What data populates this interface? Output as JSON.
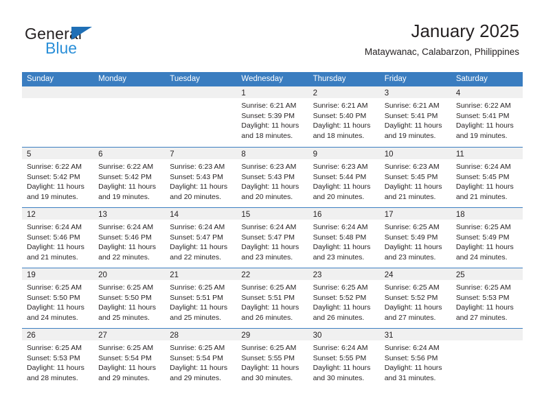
{
  "logo": {
    "word_dark": "General",
    "word_blue": "Blue",
    "triangle_color": "#1f6fb6",
    "blue_color": "#2a8fd8"
  },
  "header": {
    "title": "January 2025",
    "subtitle": "Mataywanac, Calabarzon, Philippines"
  },
  "colors": {
    "header_row_bg": "#3a7dc0",
    "day_band_bg": "#f0f0f0",
    "text": "#231f20"
  },
  "calendar": {
    "weekdays": [
      "Sunday",
      "Monday",
      "Tuesday",
      "Wednesday",
      "Thursday",
      "Friday",
      "Saturday"
    ],
    "weeks": [
      [
        {
          "day": "",
          "lines": []
        },
        {
          "day": "",
          "lines": []
        },
        {
          "day": "",
          "lines": []
        },
        {
          "day": "1",
          "lines": [
            "Sunrise: 6:21 AM",
            "Sunset: 5:39 PM",
            "Daylight: 11 hours",
            "and 18 minutes."
          ]
        },
        {
          "day": "2",
          "lines": [
            "Sunrise: 6:21 AM",
            "Sunset: 5:40 PM",
            "Daylight: 11 hours",
            "and 18 minutes."
          ]
        },
        {
          "day": "3",
          "lines": [
            "Sunrise: 6:21 AM",
            "Sunset: 5:41 PM",
            "Daylight: 11 hours",
            "and 19 minutes."
          ]
        },
        {
          "day": "4",
          "lines": [
            "Sunrise: 6:22 AM",
            "Sunset: 5:41 PM",
            "Daylight: 11 hours",
            "and 19 minutes."
          ]
        }
      ],
      [
        {
          "day": "5",
          "lines": [
            "Sunrise: 6:22 AM",
            "Sunset: 5:42 PM",
            "Daylight: 11 hours",
            "and 19 minutes."
          ]
        },
        {
          "day": "6",
          "lines": [
            "Sunrise: 6:22 AM",
            "Sunset: 5:42 PM",
            "Daylight: 11 hours",
            "and 19 minutes."
          ]
        },
        {
          "day": "7",
          "lines": [
            "Sunrise: 6:23 AM",
            "Sunset: 5:43 PM",
            "Daylight: 11 hours",
            "and 20 minutes."
          ]
        },
        {
          "day": "8",
          "lines": [
            "Sunrise: 6:23 AM",
            "Sunset: 5:43 PM",
            "Daylight: 11 hours",
            "and 20 minutes."
          ]
        },
        {
          "day": "9",
          "lines": [
            "Sunrise: 6:23 AM",
            "Sunset: 5:44 PM",
            "Daylight: 11 hours",
            "and 20 minutes."
          ]
        },
        {
          "day": "10",
          "lines": [
            "Sunrise: 6:23 AM",
            "Sunset: 5:45 PM",
            "Daylight: 11 hours",
            "and 21 minutes."
          ]
        },
        {
          "day": "11",
          "lines": [
            "Sunrise: 6:24 AM",
            "Sunset: 5:45 PM",
            "Daylight: 11 hours",
            "and 21 minutes."
          ]
        }
      ],
      [
        {
          "day": "12",
          "lines": [
            "Sunrise: 6:24 AM",
            "Sunset: 5:46 PM",
            "Daylight: 11 hours",
            "and 21 minutes."
          ]
        },
        {
          "day": "13",
          "lines": [
            "Sunrise: 6:24 AM",
            "Sunset: 5:46 PM",
            "Daylight: 11 hours",
            "and 22 minutes."
          ]
        },
        {
          "day": "14",
          "lines": [
            "Sunrise: 6:24 AM",
            "Sunset: 5:47 PM",
            "Daylight: 11 hours",
            "and 22 minutes."
          ]
        },
        {
          "day": "15",
          "lines": [
            "Sunrise: 6:24 AM",
            "Sunset: 5:47 PM",
            "Daylight: 11 hours",
            "and 23 minutes."
          ]
        },
        {
          "day": "16",
          "lines": [
            "Sunrise: 6:24 AM",
            "Sunset: 5:48 PM",
            "Daylight: 11 hours",
            "and 23 minutes."
          ]
        },
        {
          "day": "17",
          "lines": [
            "Sunrise: 6:25 AM",
            "Sunset: 5:49 PM",
            "Daylight: 11 hours",
            "and 23 minutes."
          ]
        },
        {
          "day": "18",
          "lines": [
            "Sunrise: 6:25 AM",
            "Sunset: 5:49 PM",
            "Daylight: 11 hours",
            "and 24 minutes."
          ]
        }
      ],
      [
        {
          "day": "19",
          "lines": [
            "Sunrise: 6:25 AM",
            "Sunset: 5:50 PM",
            "Daylight: 11 hours",
            "and 24 minutes."
          ]
        },
        {
          "day": "20",
          "lines": [
            "Sunrise: 6:25 AM",
            "Sunset: 5:50 PM",
            "Daylight: 11 hours",
            "and 25 minutes."
          ]
        },
        {
          "day": "21",
          "lines": [
            "Sunrise: 6:25 AM",
            "Sunset: 5:51 PM",
            "Daylight: 11 hours",
            "and 25 minutes."
          ]
        },
        {
          "day": "22",
          "lines": [
            "Sunrise: 6:25 AM",
            "Sunset: 5:51 PM",
            "Daylight: 11 hours",
            "and 26 minutes."
          ]
        },
        {
          "day": "23",
          "lines": [
            "Sunrise: 6:25 AM",
            "Sunset: 5:52 PM",
            "Daylight: 11 hours",
            "and 26 minutes."
          ]
        },
        {
          "day": "24",
          "lines": [
            "Sunrise: 6:25 AM",
            "Sunset: 5:52 PM",
            "Daylight: 11 hours",
            "and 27 minutes."
          ]
        },
        {
          "day": "25",
          "lines": [
            "Sunrise: 6:25 AM",
            "Sunset: 5:53 PM",
            "Daylight: 11 hours",
            "and 27 minutes."
          ]
        }
      ],
      [
        {
          "day": "26",
          "lines": [
            "Sunrise: 6:25 AM",
            "Sunset: 5:53 PM",
            "Daylight: 11 hours",
            "and 28 minutes."
          ]
        },
        {
          "day": "27",
          "lines": [
            "Sunrise: 6:25 AM",
            "Sunset: 5:54 PM",
            "Daylight: 11 hours",
            "and 29 minutes."
          ]
        },
        {
          "day": "28",
          "lines": [
            "Sunrise: 6:25 AM",
            "Sunset: 5:54 PM",
            "Daylight: 11 hours",
            "and 29 minutes."
          ]
        },
        {
          "day": "29",
          "lines": [
            "Sunrise: 6:25 AM",
            "Sunset: 5:55 PM",
            "Daylight: 11 hours",
            "and 30 minutes."
          ]
        },
        {
          "day": "30",
          "lines": [
            "Sunrise: 6:24 AM",
            "Sunset: 5:55 PM",
            "Daylight: 11 hours",
            "and 30 minutes."
          ]
        },
        {
          "day": "31",
          "lines": [
            "Sunrise: 6:24 AM",
            "Sunset: 5:56 PM",
            "Daylight: 11 hours",
            "and 31 minutes."
          ]
        },
        {
          "day": "",
          "lines": []
        }
      ]
    ]
  }
}
